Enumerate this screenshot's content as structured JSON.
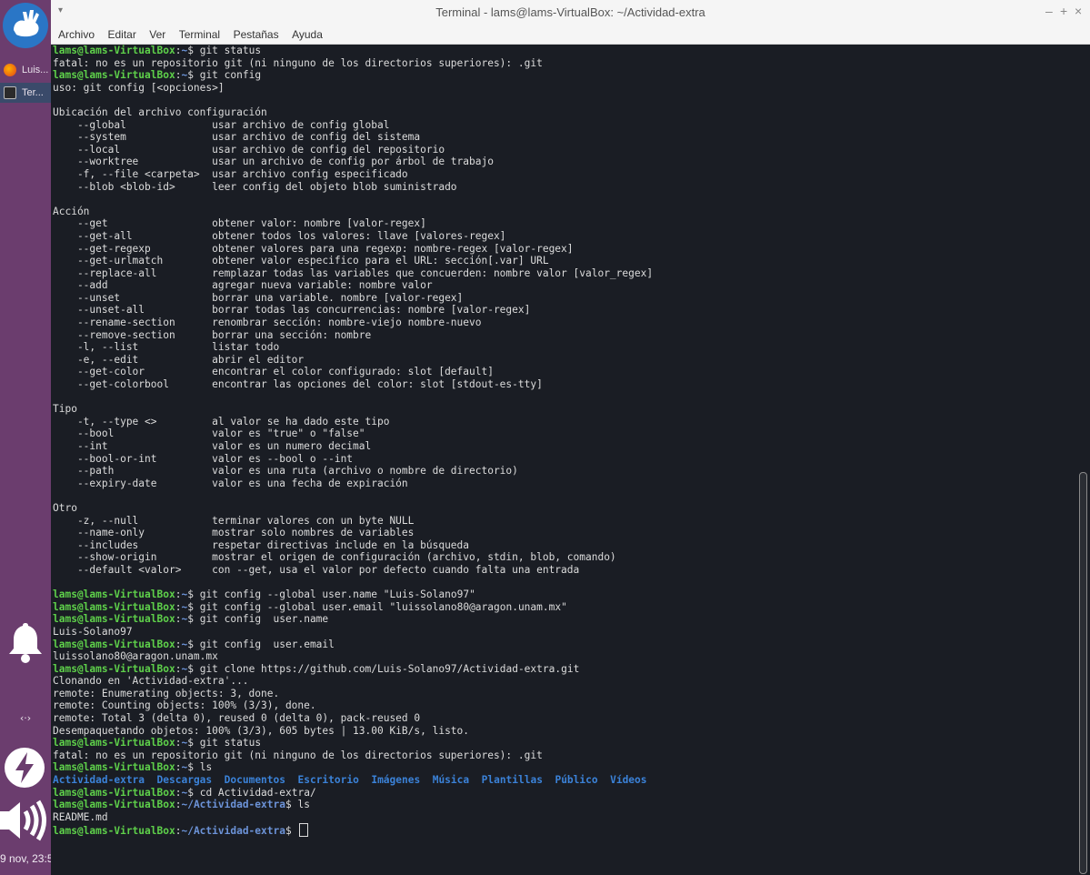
{
  "panel": {
    "tasks": [
      {
        "label": "Luis..."
      },
      {
        "label": "Ter..."
      }
    ],
    "network_label": "‹·›",
    "clock": "9 nov, 23:5"
  },
  "window": {
    "title": "Terminal - lams@lams-VirtualBox: ~/Actividad-extra",
    "controls": {
      "minimize": "–",
      "maximize": "+",
      "close": "×"
    },
    "menu": [
      "Archivo",
      "Editar",
      "Ver",
      "Terminal",
      "Pestañas",
      "Ayuda"
    ]
  },
  "terminal": {
    "lines": [
      {
        "prompt": true,
        "user": "lams@lams-VirtualBox",
        "path": "~",
        "cmd": "git status"
      },
      {
        "text": "fatal: no es un repositorio git (ni ninguno de los directorios superiores): .git"
      },
      {
        "prompt": true,
        "user": "lams@lams-VirtualBox",
        "path": "~",
        "cmd": "git config"
      },
      {
        "text": "uso: git config [<opciones>]"
      },
      {
        "text": ""
      },
      {
        "text": "Ubicación del archivo configuración"
      },
      {
        "text": "    --global              usar archivo de config global"
      },
      {
        "text": "    --system              usar archivo de config del sistema"
      },
      {
        "text": "    --local               usar archivo de config del repositorio"
      },
      {
        "text": "    --worktree            usar un archivo de config por árbol de trabajo"
      },
      {
        "text": "    -f, --file <carpeta>  usar archivo config especificado"
      },
      {
        "text": "    --blob <blob-id>      leer config del objeto blob suministrado"
      },
      {
        "text": ""
      },
      {
        "text": "Acción"
      },
      {
        "text": "    --get                 obtener valor: nombre [valor-regex]"
      },
      {
        "text": "    --get-all             obtener todos los valores: llave [valores-regex]"
      },
      {
        "text": "    --get-regexp          obtener valores para una regexp: nombre-regex [valor-regex]"
      },
      {
        "text": "    --get-urlmatch        obtener valor especifico para el URL: sección[.var] URL"
      },
      {
        "text": "    --replace-all         remplazar todas las variables que concuerden: nombre valor [valor_regex]"
      },
      {
        "text": "    --add                 agregar nueva variable: nombre valor"
      },
      {
        "text": "    --unset               borrar una variable. nombre [valor-regex]"
      },
      {
        "text": "    --unset-all           borrar todas las concurrencias: nombre [valor-regex]"
      },
      {
        "text": "    --rename-section      renombrar sección: nombre-viejo nombre-nuevo"
      },
      {
        "text": "    --remove-section      borrar una sección: nombre"
      },
      {
        "text": "    -l, --list            listar todo"
      },
      {
        "text": "    -e, --edit            abrir el editor"
      },
      {
        "text": "    --get-color           encontrar el color configurado: slot [default]"
      },
      {
        "text": "    --get-colorbool       encontrar las opciones del color: slot [stdout-es-tty]"
      },
      {
        "text": ""
      },
      {
        "text": "Tipo"
      },
      {
        "text": "    -t, --type <>         al valor se ha dado este tipo"
      },
      {
        "text": "    --bool                valor es \"true\" o \"false\""
      },
      {
        "text": "    --int                 valor es un numero decimal"
      },
      {
        "text": "    --bool-or-int         valor es --bool o --int"
      },
      {
        "text": "    --path                valor es una ruta (archivo o nombre de directorio)"
      },
      {
        "text": "    --expiry-date         valor es una fecha de expiración"
      },
      {
        "text": ""
      },
      {
        "text": "Otro"
      },
      {
        "text": "    -z, --null            terminar valores con un byte NULL"
      },
      {
        "text": "    --name-only           mostrar solo nombres de variables"
      },
      {
        "text": "    --includes            respetar directivas include en la búsqueda"
      },
      {
        "text": "    --show-origin         mostrar el origen de configuración (archivo, stdin, blob, comando)"
      },
      {
        "text": "    --default <valor>     con --get, usa el valor por defecto cuando falta una entrada"
      },
      {
        "text": ""
      },
      {
        "prompt": true,
        "user": "lams@lams-VirtualBox",
        "path": "~",
        "cmd": "git config --global user.name \"Luis-Solano97\""
      },
      {
        "prompt": true,
        "user": "lams@lams-VirtualBox",
        "path": "~",
        "cmd": "git config --global user.email \"luissolano80@aragon.unam.mx\""
      },
      {
        "prompt": true,
        "user": "lams@lams-VirtualBox",
        "path": "~",
        "cmd": "git config  user.name"
      },
      {
        "text": "Luis-Solano97"
      },
      {
        "prompt": true,
        "user": "lams@lams-VirtualBox",
        "path": "~",
        "cmd": "git config  user.email"
      },
      {
        "text": "luissolano80@aragon.unam.mx"
      },
      {
        "prompt": true,
        "user": "lams@lams-VirtualBox",
        "path": "~",
        "cmd": "git clone https://github.com/Luis-Solano97/Actividad-extra.git"
      },
      {
        "text": "Clonando en 'Actividad-extra'..."
      },
      {
        "text": "remote: Enumerating objects: 3, done."
      },
      {
        "text": "remote: Counting objects: 100% (3/3), done."
      },
      {
        "text": "remote: Total 3 (delta 0), reused 0 (delta 0), pack-reused 0"
      },
      {
        "text": "Desempaquetando objetos: 100% (3/3), 605 bytes | 13.00 KiB/s, listo."
      },
      {
        "prompt": true,
        "user": "lams@lams-VirtualBox",
        "path": "~",
        "cmd": "git status"
      },
      {
        "text": "fatal: no es un repositorio git (ni ninguno de los directorios superiores): .git"
      },
      {
        "prompt": true,
        "user": "lams@lams-VirtualBox",
        "path": "~",
        "cmd": "ls"
      },
      {
        "dirs": [
          "Actividad-extra",
          "Descargas",
          "Documentos",
          "Escritorio",
          "Imágenes",
          "Música",
          "Plantillas",
          "Público",
          "Vídeos"
        ]
      },
      {
        "prompt": true,
        "user": "lams@lams-VirtualBox",
        "path": "~",
        "cmd": "cd Actividad-extra/"
      },
      {
        "prompt": true,
        "user": "lams@lams-VirtualBox",
        "path": "~/Actividad-extra",
        "cmd": "ls"
      },
      {
        "text": "README.md"
      },
      {
        "prompt": true,
        "user": "lams@lams-VirtualBox",
        "path": "~/Actividad-extra",
        "cmd": "",
        "cursor": true
      }
    ]
  }
}
